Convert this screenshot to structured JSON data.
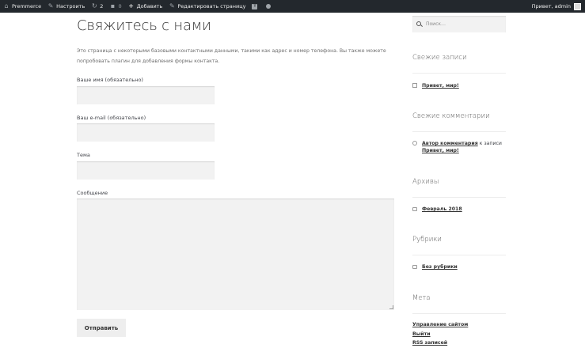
{
  "adminbar": {
    "site_name": "Premmerce",
    "customize": "Настроить",
    "updates_count": "2",
    "comments_count": "0",
    "add_new": "Добавить",
    "edit_page": "Редактировать страницу",
    "greeting": "Привет, admin"
  },
  "main": {
    "title": "Свяжитесь с нами",
    "intro": "Это страница с некоторыми базовыми контактными данными, такими как адрес и номер телефона. Вы также можете попробовать плагин для добавления формы контакта.",
    "form": {
      "name_label": "Ваше имя (обязательно)",
      "email_label": "Ваш e-mail (обязательно)",
      "subject_label": "Тема",
      "message_label": "Сообщение",
      "submit_label": "Отправить"
    }
  },
  "sidebar": {
    "search_placeholder": "Поиск…",
    "recent_posts": {
      "title": "Свежие записи",
      "items": [
        "Привет, мир!"
      ]
    },
    "recent_comments": {
      "title": "Свежие комментарии",
      "author": "Автор комментария",
      "connector": "к записи",
      "post": "Привет, мир!"
    },
    "archives": {
      "title": "Архивы",
      "items": [
        "Февраль 2018"
      ]
    },
    "categories": {
      "title": "Рубрики",
      "items": [
        "Без рубрики"
      ]
    },
    "meta": {
      "title": "Мета",
      "items": [
        "Управление сайтом",
        "Выйти",
        "RSS записей"
      ]
    }
  }
}
